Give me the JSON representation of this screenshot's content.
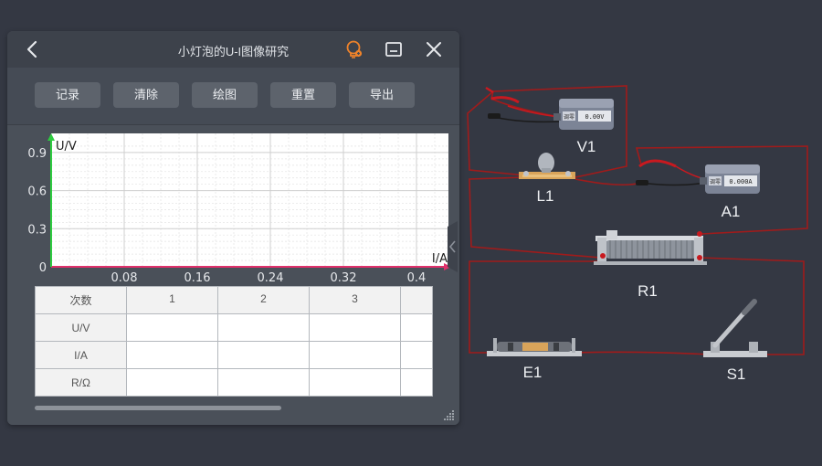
{
  "header": {
    "title": "小灯泡的U-I图像研究"
  },
  "toolbar": {
    "record": "记录",
    "clear": "清除",
    "plot": "绘图",
    "reset": "重置",
    "export": "导出"
  },
  "chart_data": {
    "type": "scatter",
    "xlabel": "I/A",
    "ylabel": "U/V",
    "xlim": [
      0,
      0.44
    ],
    "ylim": [
      0,
      1.0
    ],
    "xticks": [
      "0.08",
      "0.16",
      "0.24",
      "0.32",
      "0.4"
    ],
    "yticks": [
      "0.9",
      "0.6",
      "0.3",
      "0"
    ],
    "x": [],
    "y": [],
    "grid": true,
    "axis_color": "#2ecc40",
    "xaxis_color": "#e0306b"
  },
  "table": {
    "headers": [
      "次数",
      "1",
      "2",
      "3",
      ""
    ],
    "rows": [
      {
        "label": "U/V",
        "cells": [
          "",
          "",
          "",
          ""
        ]
      },
      {
        "label": "I/A",
        "cells": [
          "",
          "",
          "",
          ""
        ]
      },
      {
        "label": "R/Ω",
        "cells": [
          "",
          "",
          "",
          ""
        ]
      }
    ]
  },
  "circuit": {
    "voltmeter": {
      "label": "V1",
      "reading": "0.00V",
      "tag": "调零"
    },
    "ammeter": {
      "label": "A1",
      "reading": "0.000A",
      "tag": "调零"
    },
    "bulb": {
      "label": "L1"
    },
    "rheostat": {
      "label": "R1"
    },
    "battery": {
      "label": "E1"
    },
    "switch": {
      "label": "S1"
    },
    "wire_color": "#a01b1b"
  }
}
